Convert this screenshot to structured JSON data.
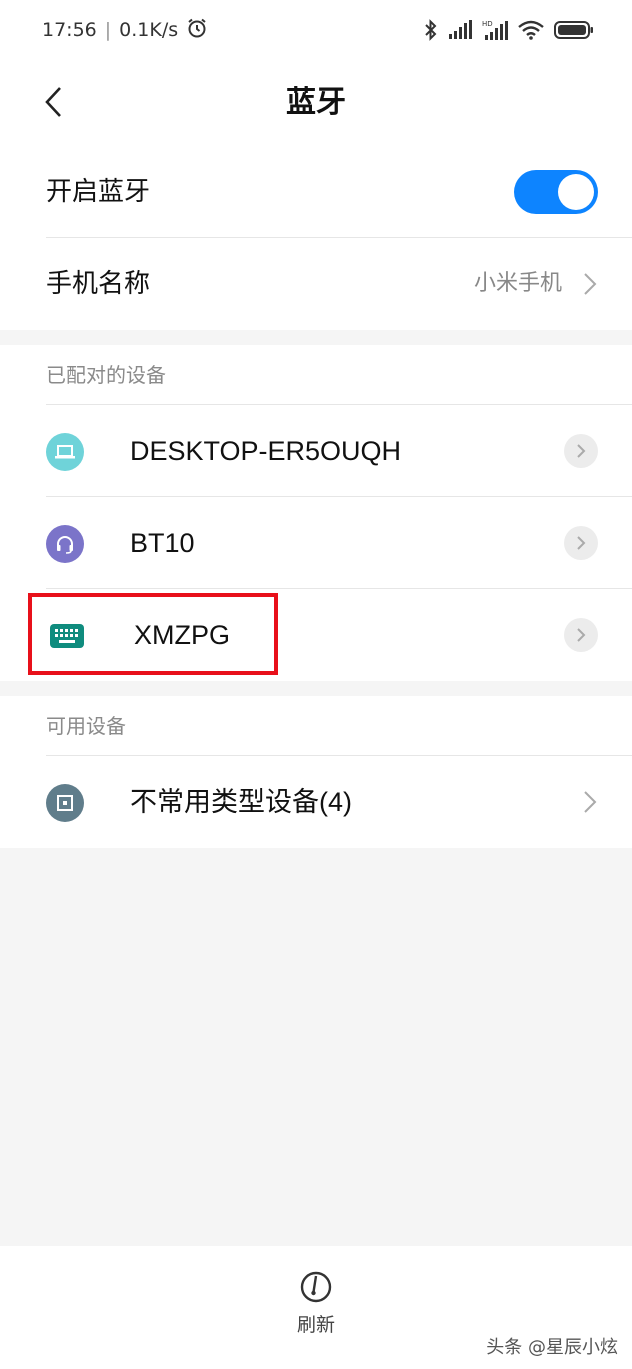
{
  "status_bar": {
    "time": "17:56",
    "net_speed": "0.1K/s",
    "icons": [
      "alarm-icon",
      "bluetooth-icon",
      "signal-icon",
      "hd-signal-icon",
      "wifi-icon",
      "battery-icon"
    ]
  },
  "header": {
    "title": "蓝牙",
    "back_icon": "chevron-left-icon"
  },
  "settings": {
    "bluetooth_toggle_label": "开启蓝牙",
    "bluetooth_enabled": true,
    "phone_name_label": "手机名称",
    "phone_name_value": "小米手机"
  },
  "paired": {
    "header": "已配对的设备",
    "devices": [
      {
        "name": "DESKTOP-ER5OUQH",
        "icon": "laptop-icon",
        "icon_color": "#6fd3d9"
      },
      {
        "name": "BT10",
        "icon": "headset-icon",
        "icon_color": "#7b74c9"
      },
      {
        "name": "XMZPG",
        "icon": "keyboard-icon",
        "icon_color": "#0f8c7e"
      }
    ]
  },
  "available": {
    "header": "可用设备",
    "devices": [
      {
        "name": "不常用类型设备(4)",
        "icon": "unknown-device-icon",
        "icon_color": "#607d8b"
      }
    ]
  },
  "bottom_bar": {
    "refresh_label": "刷新"
  },
  "watermark": "头条 @星辰小炫",
  "colors": {
    "accent": "#0d84ff",
    "highlight": "#e8101a"
  }
}
